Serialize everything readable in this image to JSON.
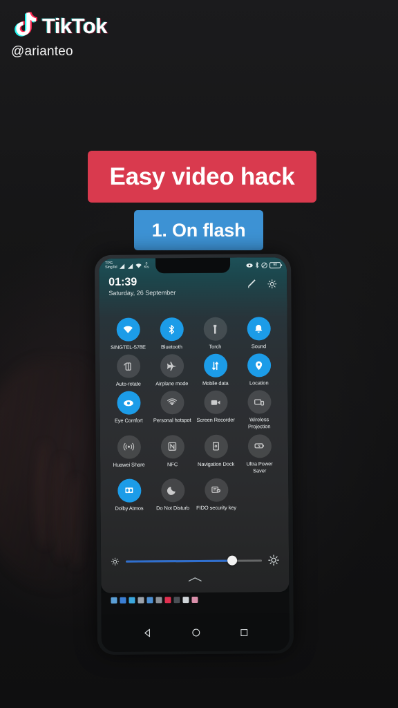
{
  "branding": {
    "app_name": "TikTok",
    "handle": "@arianteo",
    "logo_icon": "tiktok-note-icon"
  },
  "captions": {
    "headline": "Easy video hack",
    "headline_color": "#d93a4e",
    "step": "1. On flash",
    "step_color": "#3d92d4"
  },
  "phone": {
    "status_bar": {
      "carrier_line1": "TPG",
      "carrier_line2": "SingTel",
      "data_rate_value": "0",
      "data_rate_unit": "K/s",
      "battery_level": "90",
      "icons": [
        "eye-comfort-icon",
        "bluetooth-icon",
        "do-not-disturb-icon",
        "battery-icon"
      ]
    },
    "quick_settings": {
      "time": "01:39",
      "date": "Saturday, 26 September",
      "edit_icon": "pencil-icon",
      "settings_icon": "gear-icon",
      "tiles": [
        {
          "label": "SINGTEL-578E",
          "icon": "wifi-icon",
          "state": "on"
        },
        {
          "label": "Bluetooth",
          "icon": "bluetooth-icon",
          "state": "on"
        },
        {
          "label": "Torch",
          "icon": "flashlight-icon",
          "state": "off"
        },
        {
          "label": "Sound",
          "icon": "bell-icon",
          "state": "on"
        },
        {
          "label": "Auto-rotate",
          "icon": "rotate-icon",
          "state": "off"
        },
        {
          "label": "Airplane mode",
          "icon": "airplane-icon",
          "state": "off"
        },
        {
          "label": "Mobile data",
          "icon": "data-arrows-icon",
          "state": "on"
        },
        {
          "label": "Location",
          "icon": "location-pin-icon",
          "state": "on"
        },
        {
          "label": "Eye Comfort",
          "icon": "eye-icon",
          "state": "on"
        },
        {
          "label": "Personal hotspot",
          "icon": "hotspot-icon",
          "state": "off"
        },
        {
          "label": "Screen Recorder",
          "icon": "video-camera-icon",
          "state": "off"
        },
        {
          "label": "Wireless Projection",
          "icon": "cast-screen-icon",
          "state": "off"
        },
        {
          "label": "Huawei Share",
          "icon": "share-waves-icon",
          "state": "off"
        },
        {
          "label": "NFC",
          "icon": "nfc-icon",
          "state": "off"
        },
        {
          "label": "Navigation Dock",
          "icon": "nav-dock-icon",
          "state": "off"
        },
        {
          "label": "Ultra Power Saver",
          "icon": "battery-bolt-icon",
          "state": "off"
        },
        {
          "label": "Dolby Atmos",
          "icon": "dolby-icon",
          "state": "on"
        },
        {
          "label": "Do Not Disturb",
          "icon": "moon-icon",
          "state": "off"
        },
        {
          "label": "FIDO security key",
          "icon": "fido-key-icon",
          "state": "off"
        }
      ],
      "brightness": {
        "value_percent": 78,
        "low_icon": "brightness-low-icon",
        "high_icon": "brightness-high-icon"
      },
      "collapse_icon": "chevron-up-icon"
    },
    "notification_icons": [
      {
        "name": "cloud-icon",
        "color": "#5b9fd6"
      },
      {
        "name": "app-blue-square-icon",
        "color": "#3b7fd4"
      },
      {
        "name": "telegram-icon",
        "color": "#3ba7dd"
      },
      {
        "name": "instagram-icon",
        "color": "#9aa2ab"
      },
      {
        "name": "contact-icon",
        "color": "#4d8fd1"
      },
      {
        "name": "app-gray-round-icon",
        "color": "#8d9298"
      },
      {
        "name": "qq-icon",
        "color": "#e03050"
      },
      {
        "name": "mail-dark-icon",
        "color": "#4a4f55"
      },
      {
        "name": "envelope-icon",
        "color": "#cfd4d8"
      },
      {
        "name": "mail-pink-icon",
        "color": "#d98faa"
      }
    ],
    "navbar": [
      {
        "name": "back-button",
        "icon": "triangle-back-icon"
      },
      {
        "name": "home-button",
        "icon": "circle-home-icon"
      },
      {
        "name": "recents-button",
        "icon": "square-recents-icon"
      }
    ]
  },
  "theme": {
    "tile_on_color": "#1c9ce8",
    "panel_top_color": "#1d5058",
    "slider_fill_color": "#2f6fd0"
  }
}
